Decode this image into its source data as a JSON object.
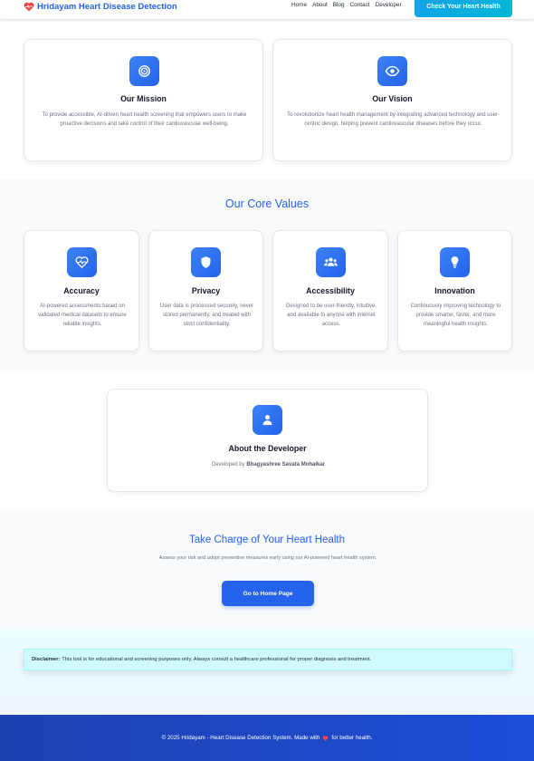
{
  "header": {
    "brand": "Hridayam Heart Disease Detection",
    "nav": [
      "Home",
      "About",
      "Blog",
      "Contact",
      "Developer"
    ],
    "cta": "Check Your Heart Health"
  },
  "mission": {
    "title": "Our Mission",
    "text": "To provide accessible, AI-driven heart health screening that empowers users to make proactive decisions and take control of their cardiovascular well-being."
  },
  "vision": {
    "title": "Our Vision",
    "text": "To revolutionize heart health management by integrating advanced technology and user-centric design, helping prevent cardiovascular diseases before they occur."
  },
  "core_values": {
    "title": "Our Core Values",
    "items": [
      {
        "title": "Accuracy",
        "text": "AI-powered assessments based on validated medical datasets to ensure reliable insights.",
        "icon": "heart-pulse-icon"
      },
      {
        "title": "Privacy",
        "text": "User data is processed securely, never stored permanently, and treated with strict confidentiality.",
        "icon": "shield-icon"
      },
      {
        "title": "Accessibility",
        "text": "Designed to be user-friendly, intuitive, and available to anyone with internet access.",
        "icon": "users-icon"
      },
      {
        "title": "Innovation",
        "text": "Continuously improving technology to provide smarter, faster, and more meaningful health insights.",
        "icon": "lightbulb-icon"
      }
    ]
  },
  "developer": {
    "title": "About the Developer",
    "prefix": "Developed by",
    "name": "Bhagyashree Savata Mohalkar"
  },
  "cta_section": {
    "title": "Take Charge of Your Heart Health",
    "text": "Assess your risk and adopt preventive measures early using our AI-powered heart health system.",
    "button": "Go to Home Page"
  },
  "disclaimer": {
    "label": "Disclaimer:",
    "text": "This tool is for educational and screening purposes only. Always consult a healthcare professional for proper diagnosis and treatment."
  },
  "footer": {
    "before": "© 2025 Hridayam - Heart Disease Detection System. Made with",
    "after": "for better health."
  },
  "colors": {
    "primary": "#2563eb",
    "footer": "#1d4ed8",
    "heart": "#ef4444",
    "disclaimer_bg": "#cffafe"
  }
}
